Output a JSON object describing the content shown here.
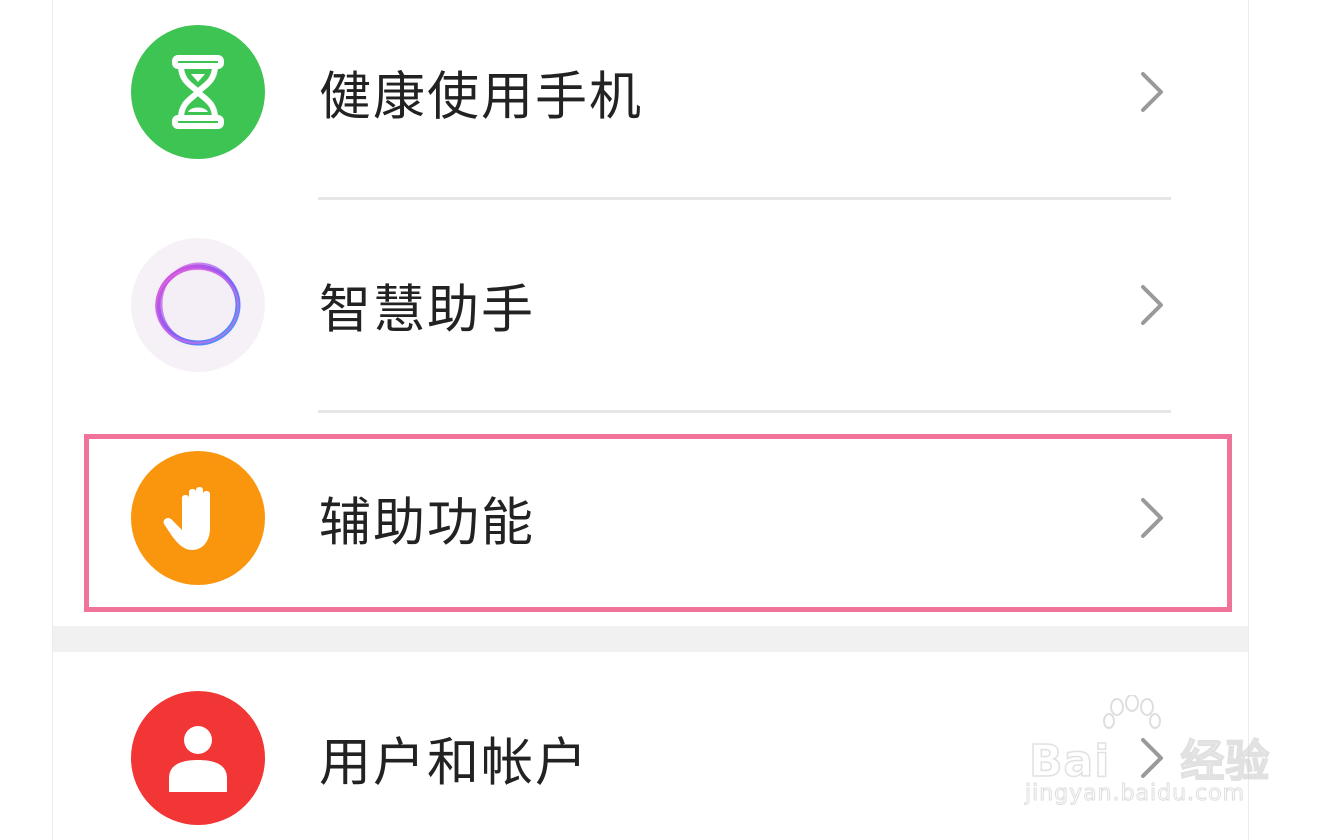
{
  "settings": {
    "items": [
      {
        "label": "健康使用手机",
        "icon": "hourglass-icon",
        "color": "#3ec453"
      },
      {
        "label": "智慧助手",
        "icon": "smart-assistant-ring-icon",
        "color": "#f6f1f6"
      },
      {
        "label": "辅助功能",
        "icon": "hand-icon",
        "color": "#fa960e"
      },
      {
        "label": "用户和帐户",
        "icon": "user-icon",
        "color": "#f23535"
      }
    ],
    "highlight_color": "#f0739a"
  },
  "watermark": {
    "brand": "Bai",
    "brand_suffix": "经验",
    "site": "jingyan.baidu.com"
  }
}
